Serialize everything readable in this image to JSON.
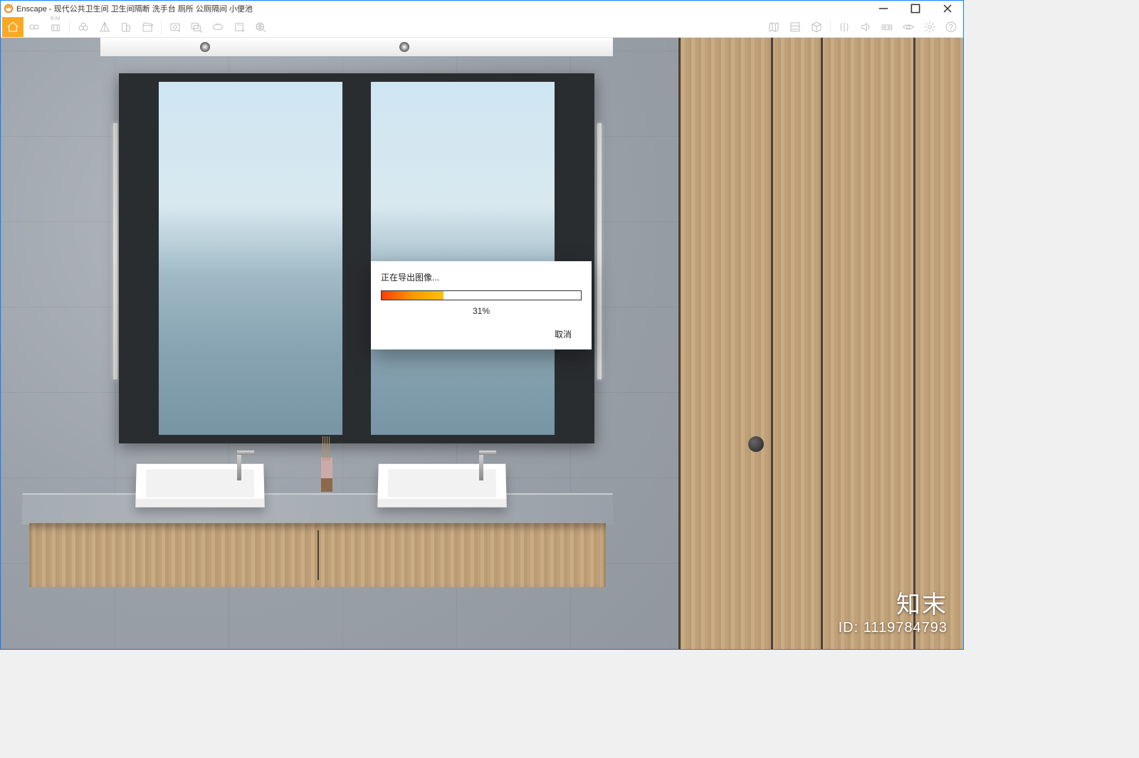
{
  "window": {
    "app_name": "Enscape",
    "title_sep": " - ",
    "doc_title": "现代公共卫生间 卫生间隔断 洗手台 厕所 公厕隔间 小便池"
  },
  "toolbar_left": [
    {
      "name": "home-icon",
      "active": true
    },
    {
      "name": "link-icon"
    },
    {
      "name": "bim-icon",
      "bim": "BIM"
    },
    {
      "name": "binoculars-icon"
    },
    {
      "name": "perspective-icon"
    },
    {
      "name": "building-icon"
    },
    {
      "name": "clapper-icon"
    },
    {
      "name": "screenshot-icon"
    },
    {
      "name": "batch-export-icon"
    },
    {
      "name": "panorama-icon"
    },
    {
      "name": "exe-export-icon"
    },
    {
      "name": "web-export-icon"
    }
  ],
  "toolbar_right": [
    {
      "name": "map-icon"
    },
    {
      "name": "asset-library-icon"
    },
    {
      "name": "cube-icon"
    },
    {
      "name": "compare-icon"
    },
    {
      "name": "sound-icon"
    },
    {
      "name": "vr-icon"
    },
    {
      "name": "visibility-icon"
    },
    {
      "name": "settings-icon"
    },
    {
      "name": "help-icon"
    }
  ],
  "dialog": {
    "title": "正在导出图像...",
    "percent_value": 31,
    "percent_label": "31%",
    "cancel_label": "取消"
  },
  "watermark": {
    "brand": "知末",
    "id_label": "ID: 1119784793"
  }
}
